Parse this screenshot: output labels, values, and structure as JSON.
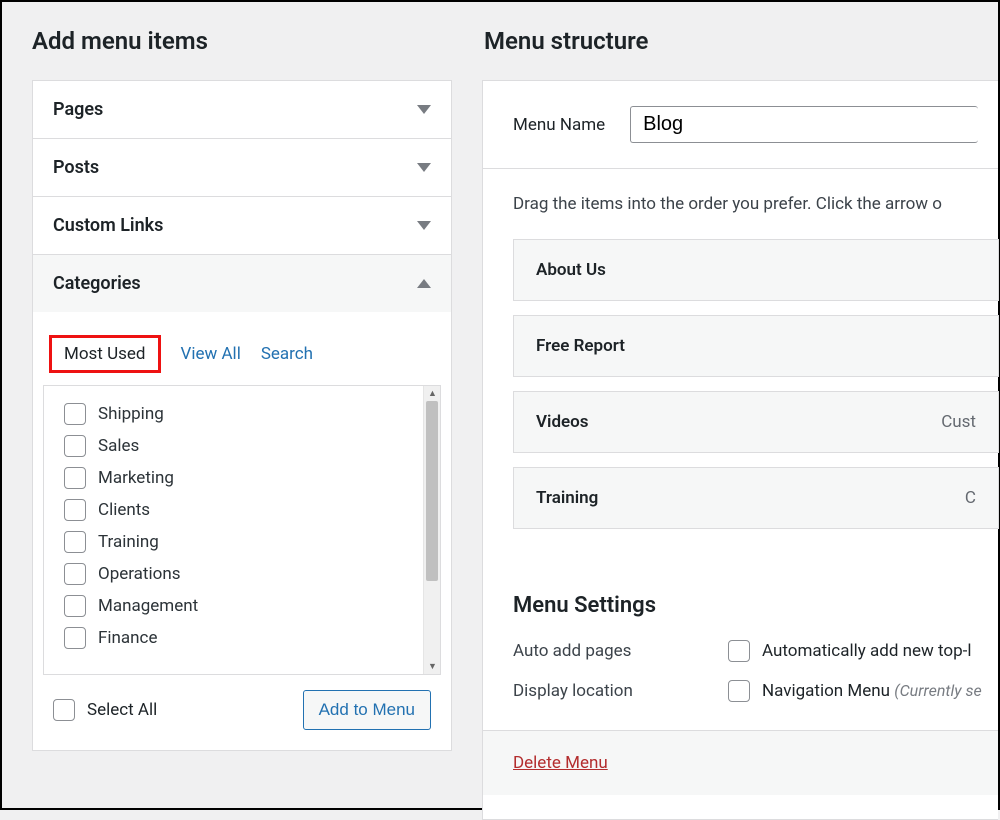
{
  "left": {
    "title": "Add menu items",
    "accordion": {
      "pages": "Pages",
      "posts": "Posts",
      "custom_links": "Custom Links",
      "categories": "Categories"
    },
    "tabs": {
      "most_used": "Most Used",
      "view_all": "View All",
      "search": "Search"
    },
    "items": [
      "Shipping",
      "Sales",
      "Marketing",
      "Clients",
      "Training",
      "Operations",
      "Management",
      "Finance"
    ],
    "select_all": "Select All",
    "add_to_menu": "Add to Menu"
  },
  "right": {
    "title": "Menu structure",
    "menu_name_label": "Menu Name",
    "menu_name_value": "Blog",
    "drag_hint": "Drag the items into the order you prefer. Click the arrow o",
    "menu_items": [
      {
        "label": "About Us",
        "meta": ""
      },
      {
        "label": "Free Report",
        "meta": ""
      },
      {
        "label": "Videos",
        "meta": "Cust"
      },
      {
        "label": "Training",
        "meta": "C"
      }
    ],
    "settings": {
      "title": "Menu Settings",
      "auto_add_label": "Auto add pages",
      "auto_add_opt": "Automatically add new top-l",
      "display_loc_label": "Display location",
      "display_loc_opt": "Navigation Menu",
      "display_loc_note": "(Currently se"
    },
    "delete": "Delete Menu"
  }
}
